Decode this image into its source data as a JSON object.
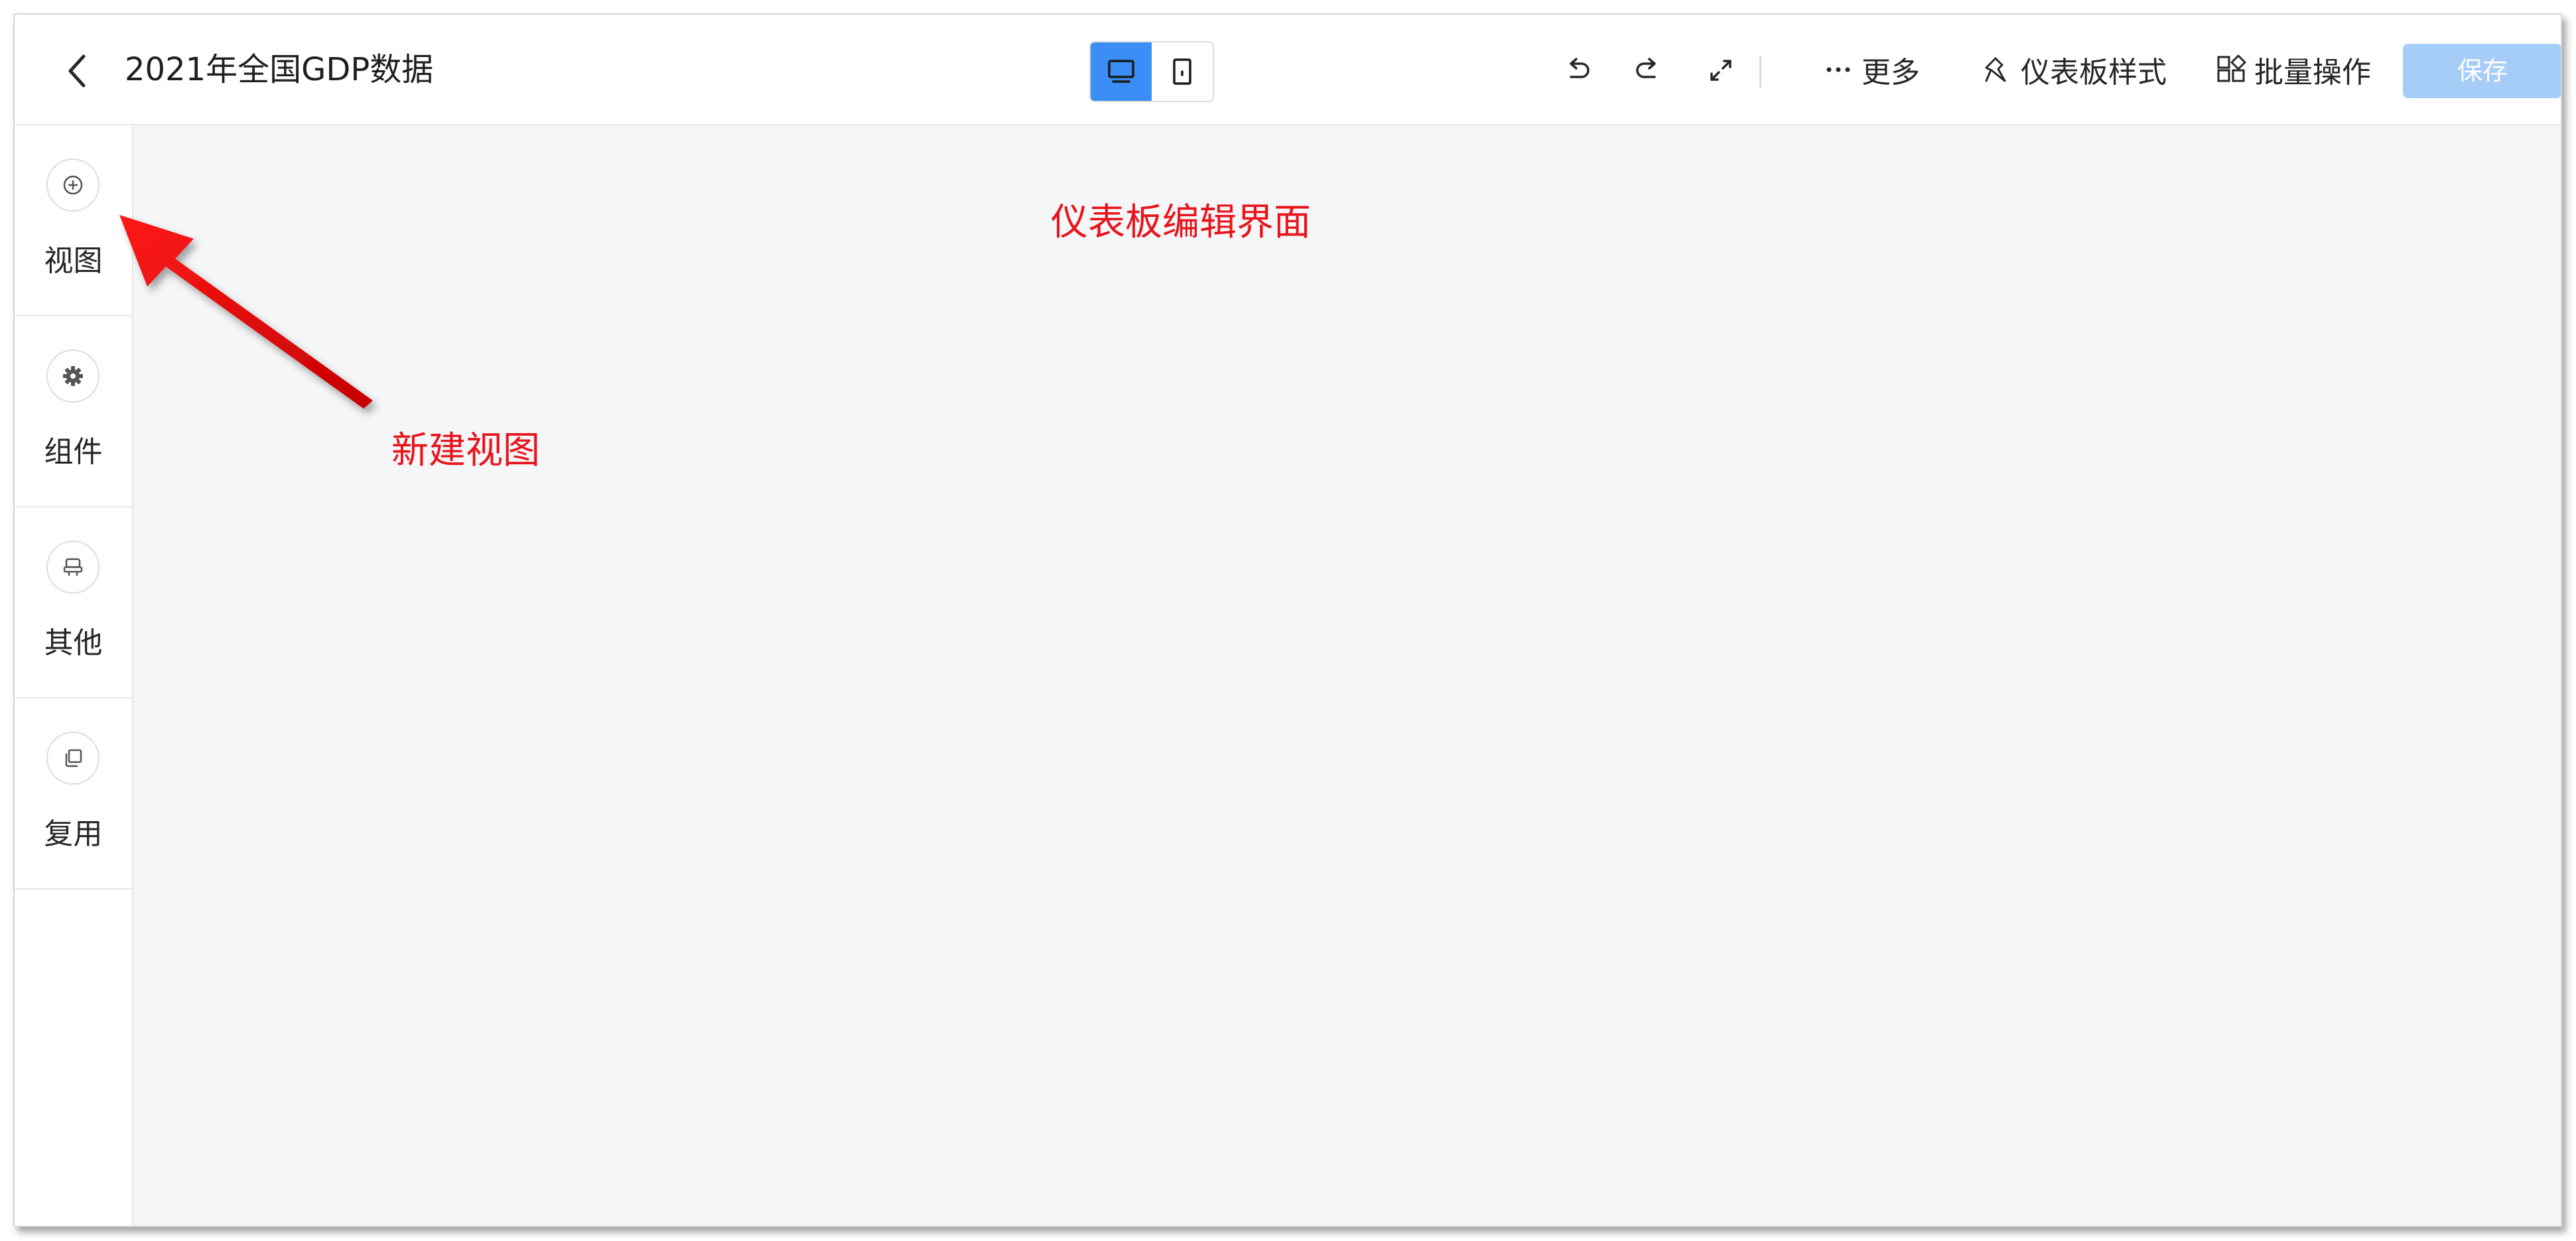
{
  "header": {
    "title": "2021年全国GDP数据",
    "back_icon": "chevron-left-icon",
    "device_toggle": {
      "desktop_icon": "desktop-monitor-icon",
      "mobile_icon": "mobile-phone-icon",
      "active": "desktop"
    },
    "tools": {
      "undo_icon": "undo-icon",
      "redo_icon": "redo-icon",
      "fullscreen_icon": "expand-icon",
      "more_label": "更多",
      "style_label": "仪表板样式",
      "batch_label": "批量操作",
      "save_label": "保存"
    }
  },
  "sidebar": {
    "items": [
      {
        "label": "视图",
        "icon": "plus-circle-icon"
      },
      {
        "label": "组件",
        "icon": "gear-icon"
      },
      {
        "label": "其他",
        "icon": "stamp-icon"
      },
      {
        "label": "复用",
        "icon": "copy-icon"
      }
    ]
  },
  "annotations": {
    "canvas_label": "仪表板编辑界面",
    "new_view_label": "新建视图"
  },
  "colors": {
    "accent": "#3a8ef6",
    "save_disabled": "#a6cdf7",
    "canvas_bg": "#f5f6f8",
    "annotation_red": "#e8141b"
  }
}
